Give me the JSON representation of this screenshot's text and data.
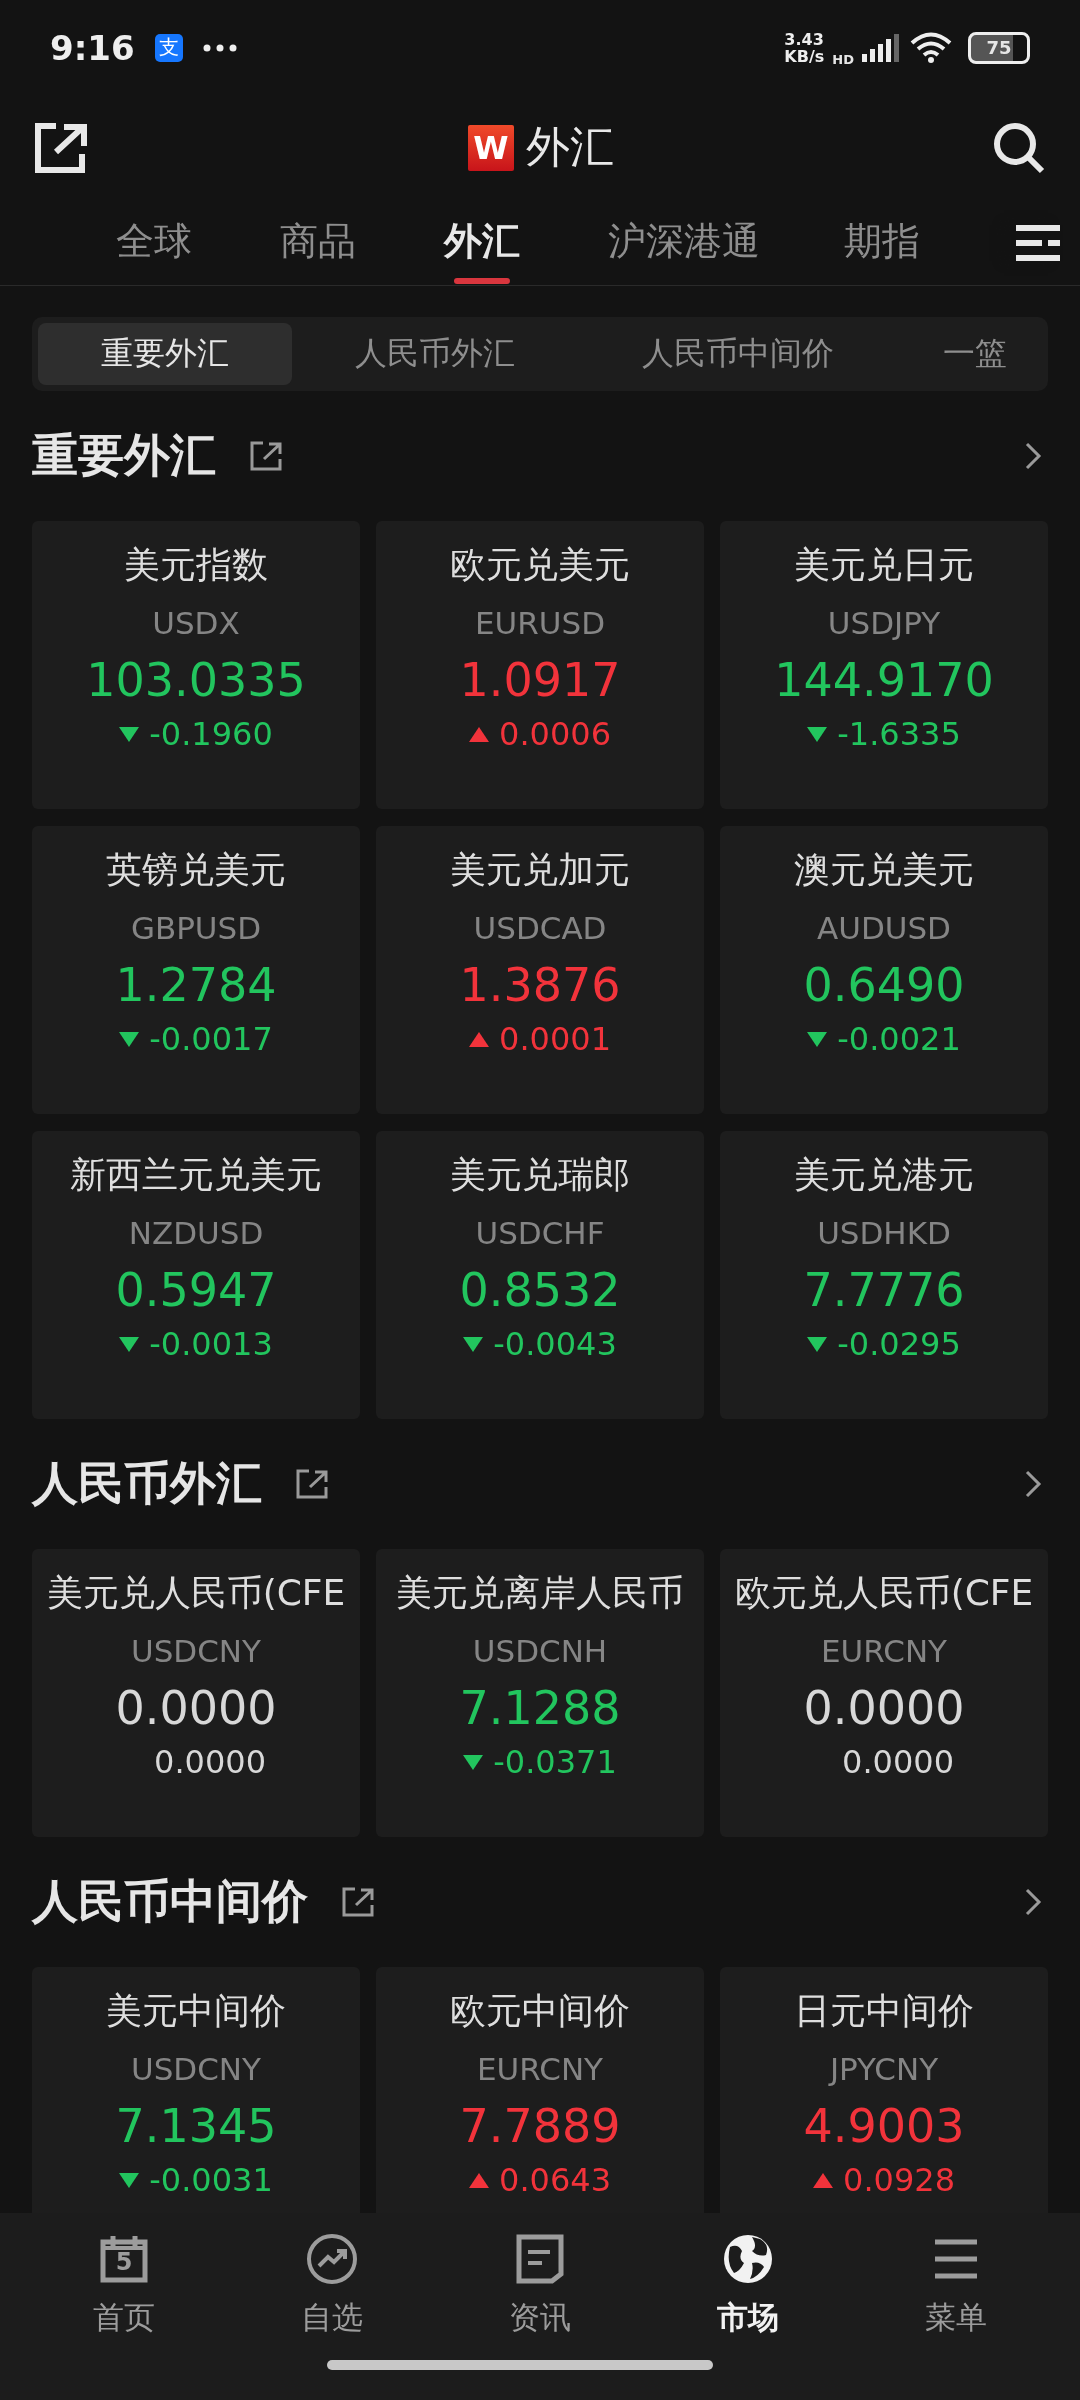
{
  "status_bar": {
    "time": "9:16",
    "app_glyph": "支",
    "speed": "3.43",
    "speed_unit": "KB/s",
    "network": "HD",
    "battery": "75"
  },
  "header": {
    "logo": "W",
    "title": "外汇"
  },
  "tabs": [
    {
      "label": "全球",
      "selected": false
    },
    {
      "label": "商品",
      "selected": false
    },
    {
      "label": "外汇",
      "selected": true
    },
    {
      "label": "沪深港通",
      "selected": false
    },
    {
      "label": "期指",
      "selected": false
    }
  ],
  "subtabs": [
    {
      "label": "重要外汇",
      "selected": true
    },
    {
      "label": "人民币外汇",
      "selected": false
    },
    {
      "label": "人民币中间价",
      "selected": false
    },
    {
      "label": "一篮",
      "selected": false
    }
  ],
  "sections": [
    {
      "title": "重要外汇",
      "cards": [
        {
          "name": "美元指数",
          "code": "USDX",
          "price": "103.0335",
          "change": "-0.1960",
          "kind": "down"
        },
        {
          "name": "欧元兑美元",
          "code": "EURUSD",
          "price": "1.0917",
          "change": "0.0006",
          "kind": "up"
        },
        {
          "name": "美元兑日元",
          "code": "USDJPY",
          "price": "144.9170",
          "change": "-1.6335",
          "kind": "down"
        },
        {
          "name": "英镑兑美元",
          "code": "GBPUSD",
          "price": "1.2784",
          "change": "-0.0017",
          "kind": "down"
        },
        {
          "name": "美元兑加元",
          "code": "USDCAD",
          "price": "1.3876",
          "change": "0.0001",
          "kind": "up"
        },
        {
          "name": "澳元兑美元",
          "code": "AUDUSD",
          "price": "0.6490",
          "change": "-0.0021",
          "kind": "down"
        },
        {
          "name": "新西兰元兑美元",
          "code": "NZDUSD",
          "price": "0.5947",
          "change": "-0.0013",
          "kind": "down"
        },
        {
          "name": "美元兑瑞郎",
          "code": "USDCHF",
          "price": "0.8532",
          "change": "-0.0043",
          "kind": "down"
        },
        {
          "name": "美元兑港元",
          "code": "USDHKD",
          "price": "7.7776",
          "change": "-0.0295",
          "kind": "down"
        }
      ]
    },
    {
      "title": "人民币外汇",
      "cards": [
        {
          "name": "美元兑人民币(CFE",
          "code": "USDCNY",
          "price": "0.0000",
          "change": "0.0000",
          "kind": "flat"
        },
        {
          "name": "美元兑离岸人民币",
          "code": "USDCNH",
          "price": "7.1288",
          "change": "-0.0371",
          "kind": "down"
        },
        {
          "name": "欧元兑人民币(CFE",
          "code": "EURCNY",
          "price": "0.0000",
          "change": "0.0000",
          "kind": "flat"
        }
      ]
    },
    {
      "title": "人民币中间价",
      "cards": [
        {
          "name": "美元中间价",
          "code": "USDCNY",
          "price": "7.1345",
          "change": "-0.0031",
          "kind": "down"
        },
        {
          "name": "欧元中间价",
          "code": "EURCNY",
          "price": "7.7889",
          "change": "0.0643",
          "kind": "up"
        },
        {
          "name": "日元中间价",
          "code": "JPYCNY",
          "price": "4.9003",
          "change": "0.0928",
          "kind": "up"
        }
      ]
    }
  ],
  "bottom_nav": [
    {
      "label": "首页",
      "kind": "calendar",
      "badge": "5",
      "selected": false
    },
    {
      "label": "自选",
      "kind": "trend",
      "selected": false
    },
    {
      "label": "资讯",
      "kind": "news",
      "selected": false
    },
    {
      "label": "市场",
      "kind": "globe",
      "selected": true
    },
    {
      "label": "菜单",
      "kind": "menu",
      "selected": false
    }
  ]
}
